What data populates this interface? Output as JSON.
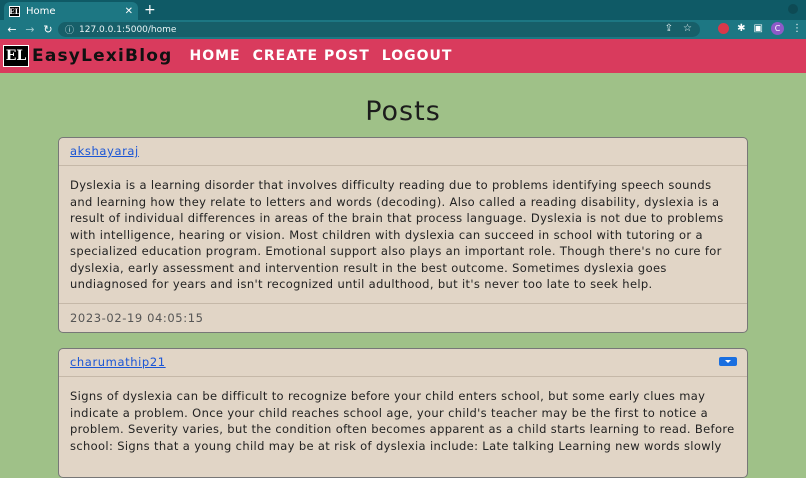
{
  "browser": {
    "tab_title": "Home",
    "tab_favicon": "EL",
    "url": "127.0.0.1:5000/home",
    "avatar_letter": "C"
  },
  "site": {
    "logo_text": "EL",
    "brand": "EasyLexiBlog",
    "nav": [
      "HOME",
      "CREATE POST",
      "LOGOUT"
    ]
  },
  "page": {
    "title": "Posts"
  },
  "posts": [
    {
      "author": "akshayaraj",
      "body": "Dyslexia is a learning disorder that involves difficulty reading due to problems identifying speech sounds and learning how they relate to letters and words (decoding). Also called a reading disability, dyslexia is a result of individual differences in areas of the brain that process language. Dyslexia is not due to problems with intelligence, hearing or vision. Most children with dyslexia can succeed in school with tutoring or a specialized education program. Emotional support also plays an important role. Though there's no cure for dyslexia, early assessment and intervention result in the best outcome. Sometimes dyslexia goes undiagnosed for years and isn't recognized until adulthood, but it's never too late to seek help.",
      "timestamp": "2023-02-19 04:05:15"
    },
    {
      "author": "charumathip21",
      "body": "Signs of dyslexia can be difficult to recognize before your child enters school, but some early clues may indicate a problem. Once your child reaches school age, your child's teacher may be the first to notice a problem. Severity varies, but the condition often becomes apparent as a child starts learning to read. Before school: Signs that a young child may be at risk of dyslexia include: Late talking Learning new words slowly"
    }
  ],
  "colors": {
    "navbar": "#d93b5d",
    "page_bg": "#9fc188",
    "card_bg": "#e1d5c6",
    "link": "#1a55d6",
    "dropdown": "#1a6fe0"
  }
}
